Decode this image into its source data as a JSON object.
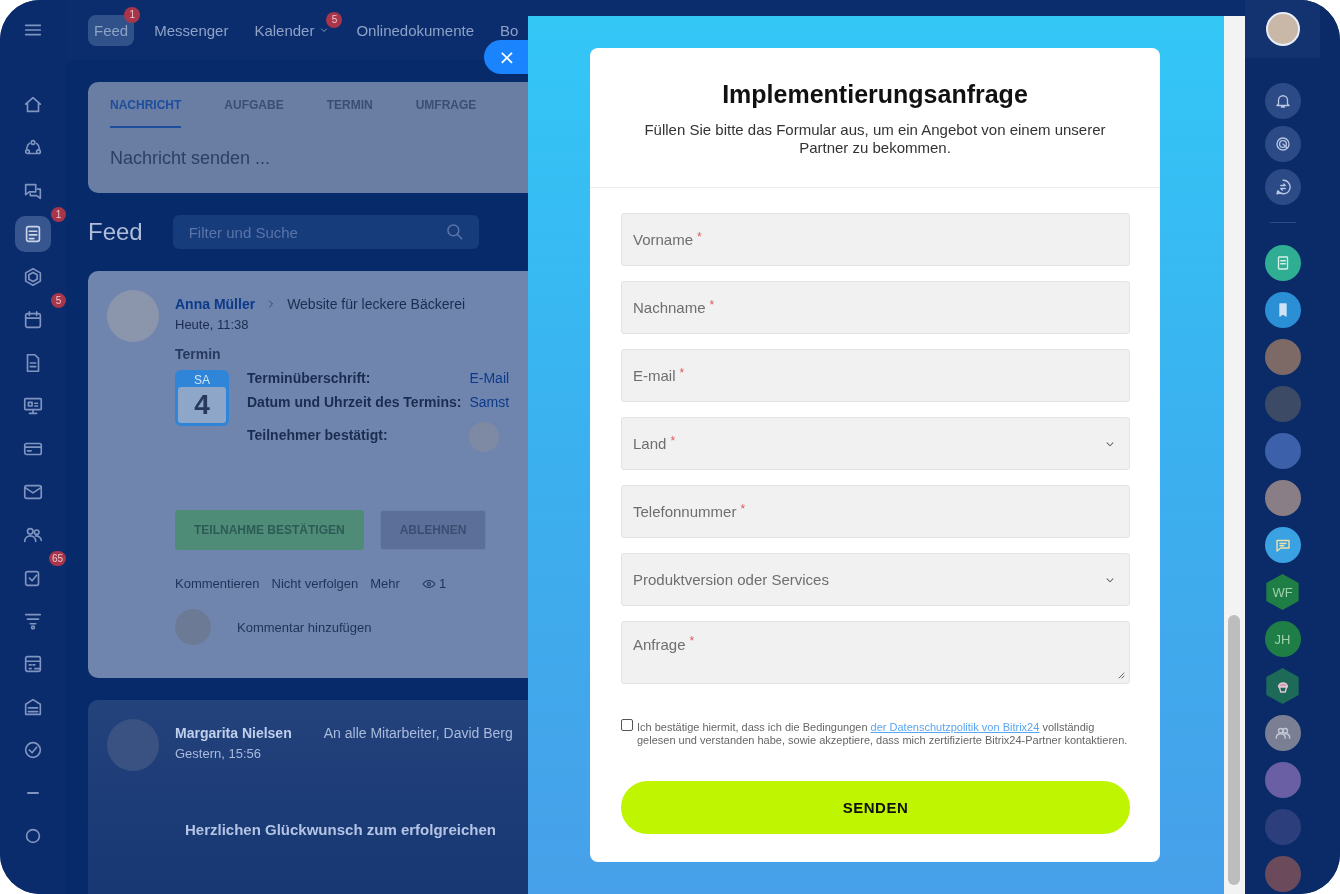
{
  "top_nav": {
    "items": [
      {
        "label": "Feed",
        "selected": true,
        "badge": "1",
        "dropdown": false
      },
      {
        "label": "Messenger",
        "selected": false,
        "dropdown": false
      },
      {
        "label": "Kalender",
        "selected": false,
        "badge": "5",
        "dropdown": true
      },
      {
        "label": "Onlinedokumente",
        "selected": false,
        "dropdown": false
      },
      {
        "label": "Bo",
        "selected": false,
        "dropdown": false
      }
    ]
  },
  "sidebar": {
    "items": [
      {
        "selected": false
      },
      {
        "selected": false
      },
      {
        "selected": false
      },
      {
        "selected": true,
        "badge": "1"
      },
      {
        "selected": false
      },
      {
        "selected": false,
        "badge": "5"
      },
      {
        "selected": false
      },
      {
        "selected": false
      },
      {
        "selected": false
      },
      {
        "selected": false
      },
      {
        "selected": false
      },
      {
        "selected": false,
        "badge": "65"
      },
      {
        "selected": false
      },
      {
        "selected": false
      },
      {
        "selected": false
      },
      {
        "selected": false
      },
      {
        "selected": false
      },
      {
        "selected": false
      }
    ]
  },
  "composer": {
    "tabs": [
      {
        "label": "NACHRICHT",
        "selected": true
      },
      {
        "label": "AUFGABE",
        "selected": false
      },
      {
        "label": "TERMIN",
        "selected": false
      },
      {
        "label": "UMFRAGE",
        "selected": false
      }
    ],
    "placeholder": "Nachricht senden ..."
  },
  "feed": {
    "title": "Feed",
    "search": {
      "placeholder": "Filter und Suche"
    },
    "posts": [
      {
        "author": "Anna Müller",
        "destination": "Website für leckere Bäckerei",
        "time": "Heute, 11:38",
        "type_label": "Termin",
        "event": {
          "weekday": "SA",
          "day": "4",
          "fields": [
            {
              "label": "Terminüberschrift:",
              "kind": "text",
              "value": "E-Mail"
            },
            {
              "label": "Datum und Uhrzeit des Termins:",
              "kind": "text",
              "value": "Samst"
            },
            {
              "label": "Teilnehmer bestätigt:",
              "kind": "avatars"
            }
          ]
        },
        "buttons": [
          {
            "label": "TEILNAHME BESTÄTIGEN",
            "kind": "primary"
          },
          {
            "label": "ABLEHNEN",
            "kind": "secondary"
          }
        ],
        "actions": [
          "Kommentieren",
          "Nicht verfolgen",
          "Mehr"
        ],
        "views": "1",
        "comment_placeholder": "Kommentar hinzufügen"
      },
      {
        "author": "Margarita Nielsen",
        "destination": "An alle Mitarbeiter, David Berg",
        "time": "Gestern, 15:56",
        "headline": "Herzlichen Glückwunsch zum erfolgreichen"
      }
    ]
  },
  "slider": {
    "close": "×",
    "form": {
      "title": "Implementierungsanfrage",
      "subtitle": "Füllen Sie bitte das Formular aus, um ein Angebot von einem unserer Partner zu bekommen.",
      "fields": [
        {
          "kind": "text",
          "placeholder": "Vorname",
          "required_mark": "*"
        },
        {
          "kind": "text",
          "placeholder": "Nachname",
          "required_mark": "*"
        },
        {
          "kind": "text",
          "placeholder": "E-mail",
          "required_mark": "*"
        },
        {
          "kind": "select",
          "placeholder": "Land",
          "required_mark": "*"
        },
        {
          "kind": "text",
          "placeholder": "Telefonnummer",
          "required_mark": "*"
        },
        {
          "kind": "select",
          "placeholder": "Produktversion oder Services"
        },
        {
          "kind": "textarea",
          "placeholder": "Anfrage",
          "required_mark": "*"
        }
      ],
      "consent": {
        "checked": false,
        "text": "Ich bestätige hiermit, dass ich die Bedingungen ",
        "link": "der Datenschutzpolitik von Bitrix24",
        "text_after": " vollständig gelesen und verstanden habe, sowie akzeptiere, dass mich zertifizierte Bitrix24-Partner kontaktieren."
      },
      "submit": "SENDEN"
    }
  },
  "right_rail": {
    "chats": [
      {
        "kind": "document",
        "color": "#2fae93"
      },
      {
        "kind": "bookmark",
        "color": "#2b8fd6"
      },
      {
        "kind": "photo",
        "color": "#7d6a66"
      },
      {
        "kind": "photo",
        "color": "#3d4a66"
      },
      {
        "kind": "photo",
        "color": "#3c61aa"
      },
      {
        "kind": "photo",
        "color": "#8a7e86"
      },
      {
        "kind": "chat",
        "color": "#3aa2e2"
      },
      {
        "kind": "hexinitials",
        "initials": "WF",
        "color": "#1f7d46"
      },
      {
        "kind": "initials",
        "initials": "JH",
        "color": "#1f7d46"
      },
      {
        "kind": "cupcake",
        "color": "#1d6a58"
      },
      {
        "kind": "group",
        "color": "#7a7f94"
      },
      {
        "kind": "photo",
        "color": "#6a5fa4"
      },
      {
        "kind": "photo",
        "color": "#2c3f7c"
      },
      {
        "kind": "photo",
        "color": "#6b4a5c"
      }
    ]
  }
}
